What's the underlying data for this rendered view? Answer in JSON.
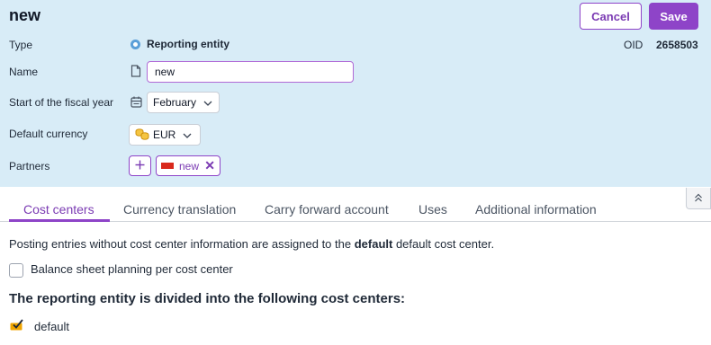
{
  "header": {
    "title": "new",
    "cancel_label": "Cancel",
    "save_label": "Save",
    "oid_label": "OID",
    "oid_value": "2658503"
  },
  "form": {
    "type": {
      "label": "Type",
      "value": "Reporting entity",
      "icon": "radio-icon"
    },
    "name": {
      "label": "Name",
      "value": "new",
      "icon": "document-icon"
    },
    "fiscal_year": {
      "label": "Start of the fiscal year",
      "value": "February",
      "icon": "calendar-icon"
    },
    "currency": {
      "label": "Default currency",
      "value": "EUR",
      "icon": "coins-icon"
    },
    "partners": {
      "label": "Partners",
      "items": [
        {
          "label": "new",
          "icon": "flag-icon",
          "flag_color": "#d9291c"
        }
      ]
    }
  },
  "tabs": [
    {
      "label": "Cost centers",
      "active": true
    },
    {
      "label": "Currency translation",
      "active": false
    },
    {
      "label": "Carry forward account",
      "active": false
    },
    {
      "label": "Uses",
      "active": false
    },
    {
      "label": "Additional information",
      "active": false
    }
  ],
  "cost_centers": {
    "info_prefix": "Posting entries without cost center information are assigned to the ",
    "info_bold": "default",
    "info_suffix": " default cost center.",
    "checkbox_label": "Balance sheet planning per cost center",
    "checkbox_checked": false,
    "heading": "The reporting entity is divided into the following cost centers:",
    "items": [
      {
        "label": "default",
        "icon": "cost-center-icon"
      }
    ]
  },
  "colors": {
    "accent": "#8e44c8",
    "panel_background": "#d8ecf7",
    "radio": "#5b9fd8",
    "flag": "#d9291c",
    "cost_center_icon": "#f0a500"
  }
}
